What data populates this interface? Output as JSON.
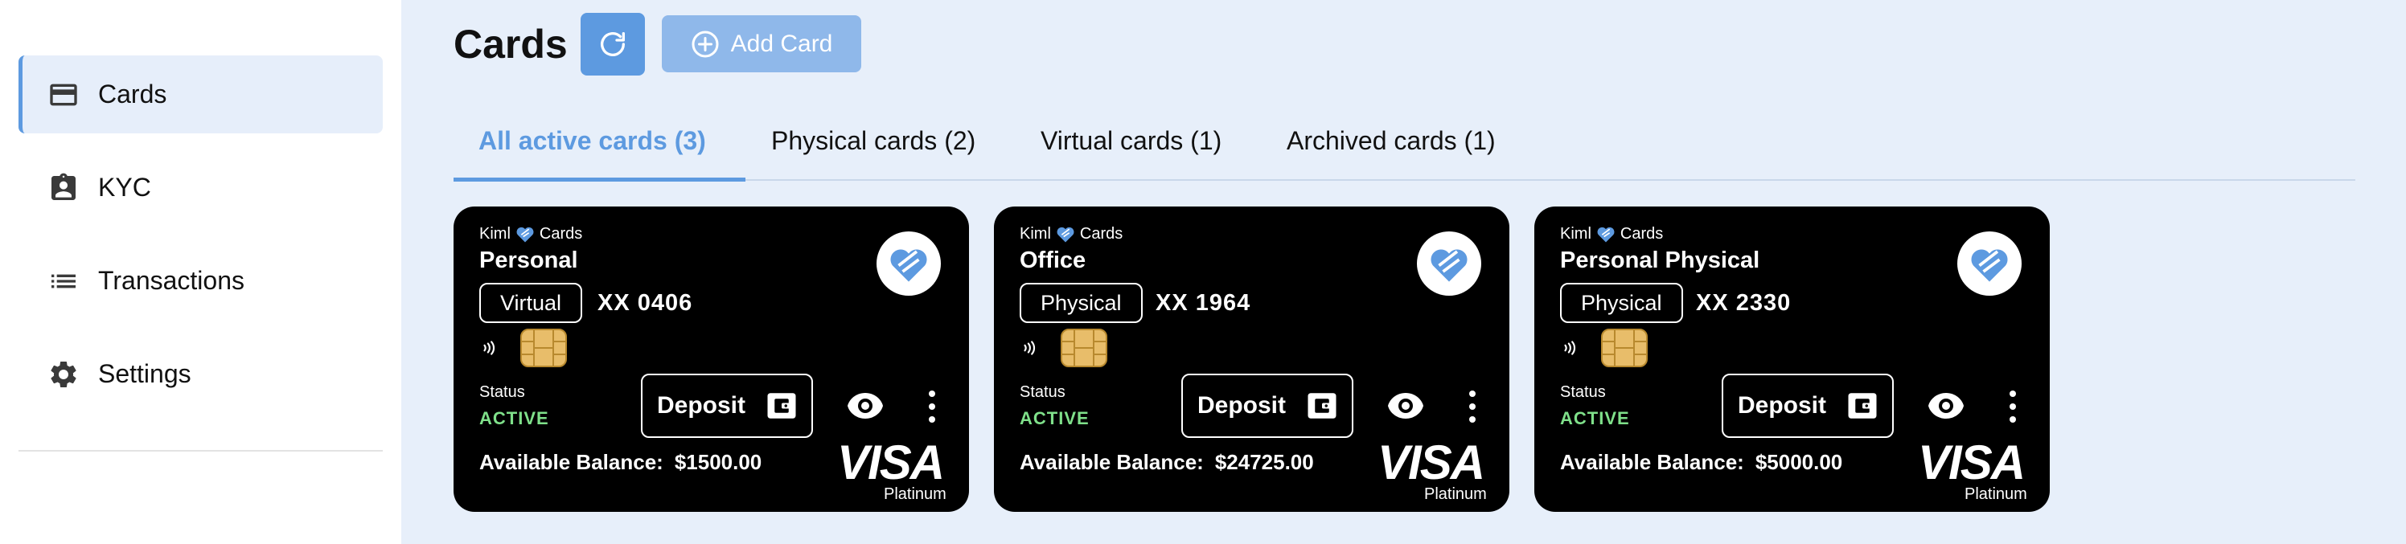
{
  "sidebar": {
    "items": [
      {
        "label": "Cards",
        "icon": "credit-card-icon",
        "active": true
      },
      {
        "label": "KYC",
        "icon": "id-badge-icon",
        "active": false
      },
      {
        "label": "Transactions",
        "icon": "list-icon",
        "active": false
      },
      {
        "label": "Settings",
        "icon": "gear-icon",
        "active": false
      }
    ]
  },
  "header": {
    "title": "Cards",
    "refresh_icon": "refresh-icon",
    "add_label": "Add Card",
    "add_icon": "plus-circle-icon"
  },
  "tabs": [
    {
      "label": "All active cards (3)",
      "active": true
    },
    {
      "label": "Physical cards (2)",
      "active": false
    },
    {
      "label": "Virtual cards (1)",
      "active": false
    },
    {
      "label": "Archived cards (1)",
      "active": false
    }
  ],
  "cards": [
    {
      "brand_left": "Kiml",
      "brand_right": "Cards",
      "name": "Personal",
      "type": "Virtual",
      "number": "XX  0406",
      "status_label": "Status",
      "status": "ACTIVE",
      "deposit": "Deposit",
      "balance_label": "Available Balance:",
      "balance": "$1500.00",
      "network": "VISA",
      "tier": "Platinum"
    },
    {
      "brand_left": "Kiml",
      "brand_right": "Cards",
      "name": "Office",
      "type": "Physical",
      "number": "XX  1964",
      "status_label": "Status",
      "status": "ACTIVE",
      "deposit": "Deposit",
      "balance_label": "Available Balance:",
      "balance": "$24725.00",
      "network": "VISA",
      "tier": "Platinum"
    },
    {
      "brand_left": "Kiml",
      "brand_right": "Cards",
      "name": "Personal Physical",
      "type": "Physical",
      "number": "XX  2330",
      "status_label": "Status",
      "status": "ACTIVE",
      "deposit": "Deposit",
      "balance_label": "Available Balance:",
      "balance": "$5000.00",
      "network": "VISA",
      "tier": "Platinum"
    }
  ],
  "colors": {
    "accent": "#5d9ae0",
    "accent_light": "#8fb8ea",
    "main_bg": "#e7effa",
    "active_item_bg": "#e6eefa",
    "card_bg": "#000000",
    "status_active": "#7fe08a"
  }
}
